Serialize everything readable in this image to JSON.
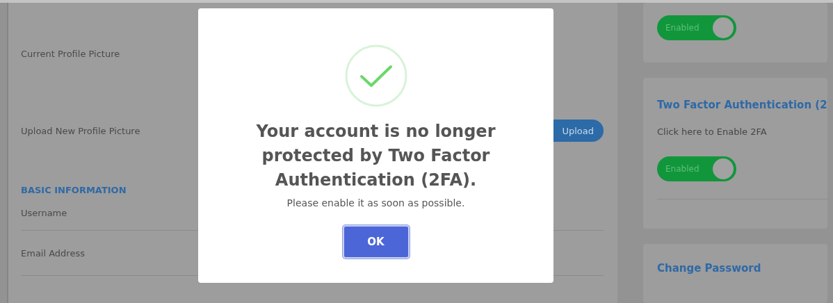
{
  "profile": {
    "rows": [
      {
        "label": "Current Profile Picture"
      },
      {
        "label": "Upload New Profile Picture",
        "button": "Upload"
      }
    ],
    "section_title": "BASIC INFORMATION",
    "fields": [
      {
        "label": "Username"
      },
      {
        "label": "Email Address"
      }
    ]
  },
  "side_cards": [
    {
      "toggle": {
        "label": "Enabled",
        "on": true
      }
    },
    {
      "title": "Two Factor Authentication (2",
      "text": "Click here to Enable 2FA",
      "toggle": {
        "label": "Enabled",
        "on": true
      }
    },
    {
      "title": "Change Password"
    }
  ],
  "modal": {
    "title": "Your account is no longer protected by Two Factor Authentication (2FA).",
    "message": "Please enable it as soon as possible.",
    "button": "OK"
  }
}
